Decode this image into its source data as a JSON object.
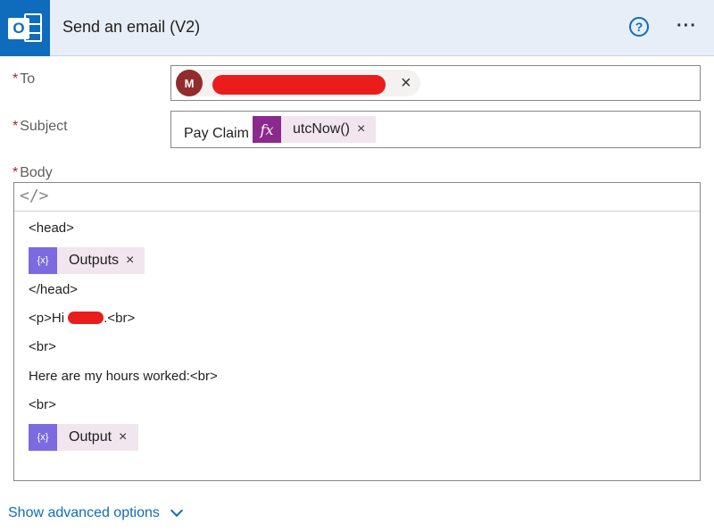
{
  "header": {
    "title": "Send an email (V2)",
    "app_icon_letter": "O",
    "help_glyph": "?",
    "more_glyph": "···"
  },
  "to": {
    "required_mark": "*",
    "label": "To",
    "recipient_initial": "M",
    "remove_glyph": "×"
  },
  "subject": {
    "required_mark": "*",
    "label": "Subject",
    "text": "Pay Claim",
    "token_icon": "fx",
    "token_label": "utcNow()",
    "remove_glyph": "×"
  },
  "body": {
    "required_mark": "*",
    "label": "Body",
    "code_view_glyph": "</>",
    "lines": {
      "head_open": "<head>",
      "token1_label": "Outputs",
      "token1_icon": "{x}",
      "head_close": "</head>",
      "greeting_start": "<p>Hi ",
      "greeting_end": ".<br>",
      "br1": "<br>",
      "hours": "Here are my hours worked:<br>",
      "br2": "<br>",
      "token2_label": "Output",
      "token2_icon": "{x}"
    },
    "remove_glyph": "×"
  },
  "advanced": {
    "label": "Show advanced options"
  },
  "colors": {
    "accent": "#0f6cbd",
    "fx_token": "#8b2a8c",
    "variable_token": "#7c6be0",
    "token_background": "#f1e6ee",
    "required": "#a4262c"
  }
}
